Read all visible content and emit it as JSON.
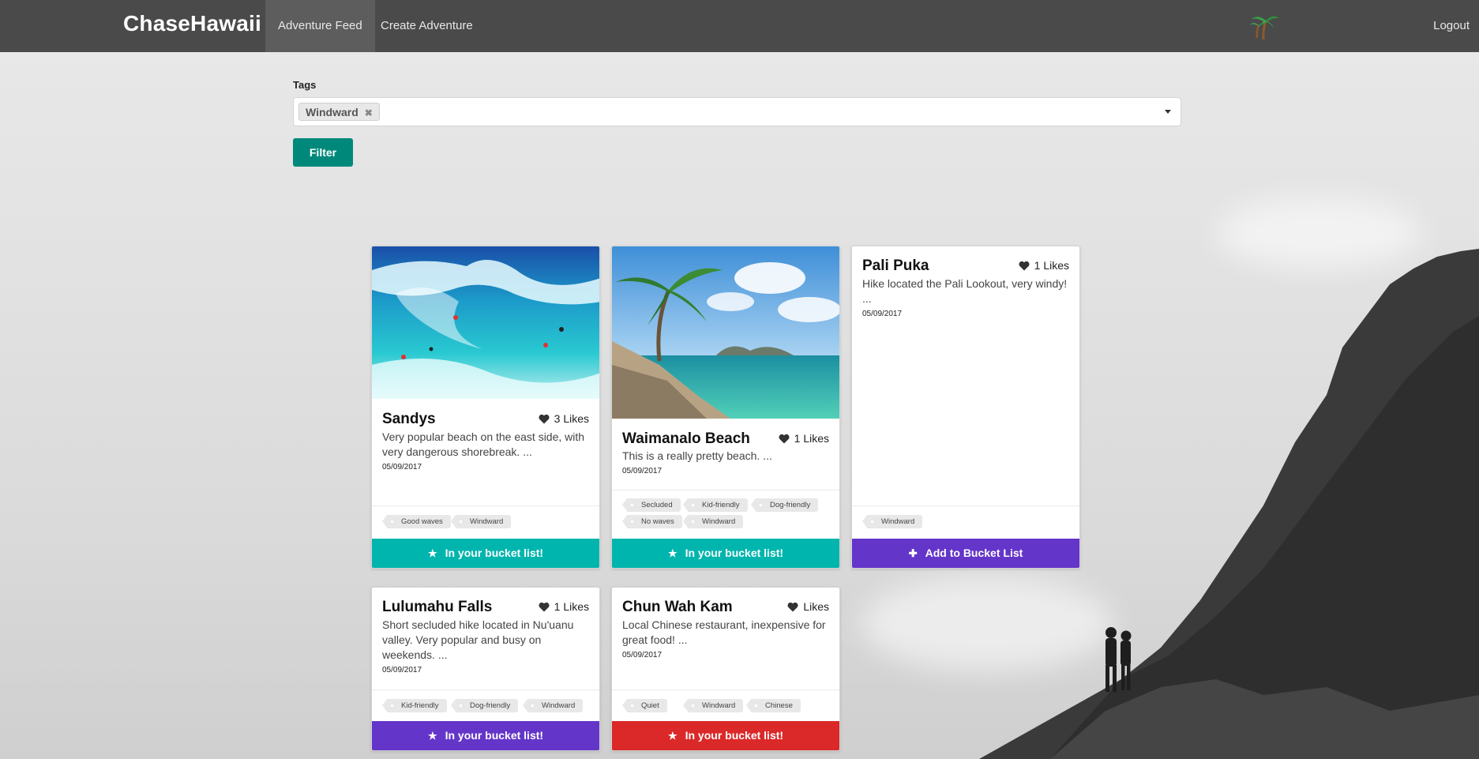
{
  "nav": {
    "brand": "ChaseHawaii",
    "links": [
      {
        "label": "Adventure Feed",
        "active": true
      },
      {
        "label": "Create Adventure",
        "active": false
      }
    ],
    "logo_icon": "palm-tree-icon",
    "logout_label": "Logout",
    "background_color": "#4a4a4a"
  },
  "filter": {
    "label": "Tags",
    "selected_tags": [
      "Windward"
    ],
    "button_label": "Filter",
    "button_color": "#00897b"
  },
  "cards": [
    {
      "title": "Sandys",
      "likes": "3 Likes",
      "description": "Very popular beach on the east side, with very dangerous shorebreak. ...",
      "date": "05/09/2017",
      "tags": [
        "Good waves",
        "Windward"
      ],
      "button_label": "In your bucket list!",
      "button_icon": "star-icon",
      "button_color": "#00b5ad",
      "image": "wave-beach-photo"
    },
    {
      "title": "Waimanalo Beach",
      "likes": "1 Likes",
      "description": "This is a really pretty beach. ...",
      "date": "05/09/2017",
      "tags": [
        "Secluded",
        "Kid-friendly",
        "Dog-friendly",
        "No waves",
        "Windward"
      ],
      "button_label": "In your bucket list!",
      "button_icon": "star-icon",
      "button_color": "#00b5ad",
      "image": "palm-beach-photo"
    },
    {
      "title": "Pali Puka",
      "likes": "1 Likes",
      "description": "Hike located the Pali Lookout, very windy! ...",
      "date": "05/09/2017",
      "tags": [
        "Windward"
      ],
      "button_label": "Add to Bucket List",
      "button_icon": "plus-icon",
      "button_color": "#6435c9"
    },
    {
      "title": "Lulumahu Falls",
      "likes": "1 Likes",
      "description": "Short secluded hike located in Nu'uanu valley. Very popular and busy on weekends. ...",
      "date": "05/09/2017",
      "tags": [
        "Kid-friendly",
        "Dog-friendly",
        "Windward"
      ],
      "button_label": "In your bucket list!",
      "button_icon": "star-icon",
      "button_color": "#6435c9"
    },
    {
      "title": "Chun Wah Kam",
      "likes": "Likes",
      "description": "Local Chinese restaurant, inexpensive for great food! ...",
      "date": "05/09/2017",
      "tags": [
        "Quiet",
        "Windward",
        "Chinese"
      ],
      "button_label": "In your bucket list!",
      "button_icon": "star-icon",
      "button_color": "#db2828"
    }
  ]
}
